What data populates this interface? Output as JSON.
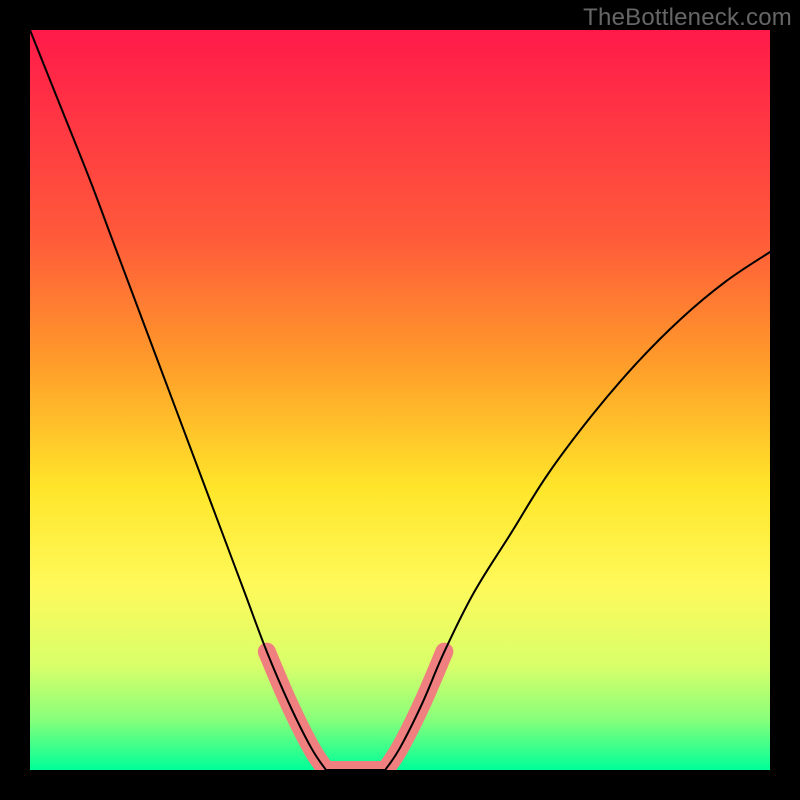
{
  "watermark": "TheBottleneck.com",
  "chart_data": {
    "type": "line",
    "title": "",
    "xlabel": "",
    "ylabel": "",
    "xlim": [
      0,
      100
    ],
    "ylim": [
      0,
      100
    ],
    "gradient_stops": [
      {
        "offset": 0,
        "color": "#ff1a4a"
      },
      {
        "offset": 28,
        "color": "#ff5a3a"
      },
      {
        "offset": 45,
        "color": "#ff9c2a"
      },
      {
        "offset": 62,
        "color": "#ffe62a"
      },
      {
        "offset": 75,
        "color": "#fff95a"
      },
      {
        "offset": 86,
        "color": "#d8ff6a"
      },
      {
        "offset": 93,
        "color": "#8aff7a"
      },
      {
        "offset": 100,
        "color": "#00ff99"
      }
    ],
    "series": [
      {
        "name": "left-curve",
        "x": [
          0,
          4,
          8,
          11,
          14,
          17,
          20,
          23,
          26,
          29,
          32,
          35,
          38,
          40
        ],
        "y": [
          100,
          90,
          80,
          72,
          64,
          56,
          48,
          40,
          32,
          24,
          16,
          9,
          3,
          0
        ]
      },
      {
        "name": "right-curve",
        "x": [
          48,
          50,
          53,
          56,
          60,
          65,
          70,
          76,
          82,
          88,
          94,
          100
        ],
        "y": [
          0,
          3,
          9,
          16,
          24,
          32,
          40,
          48,
          55,
          61,
          66,
          70
        ]
      },
      {
        "name": "trough",
        "x": [
          40,
          42,
          44,
          46,
          48
        ],
        "y": [
          0,
          0,
          0,
          0,
          0
        ]
      }
    ],
    "highlight_segments": [
      {
        "on": "left-curve",
        "x_from": 32,
        "x_to": 40
      },
      {
        "on": "trough",
        "x_from": 40,
        "x_to": 48
      },
      {
        "on": "right-curve",
        "x_from": 48,
        "x_to": 56
      }
    ],
    "highlight_color": "#f08080",
    "highlight_stroke_width": 18,
    "curve_color": "#000000",
    "curve_stroke_width": 2
  }
}
